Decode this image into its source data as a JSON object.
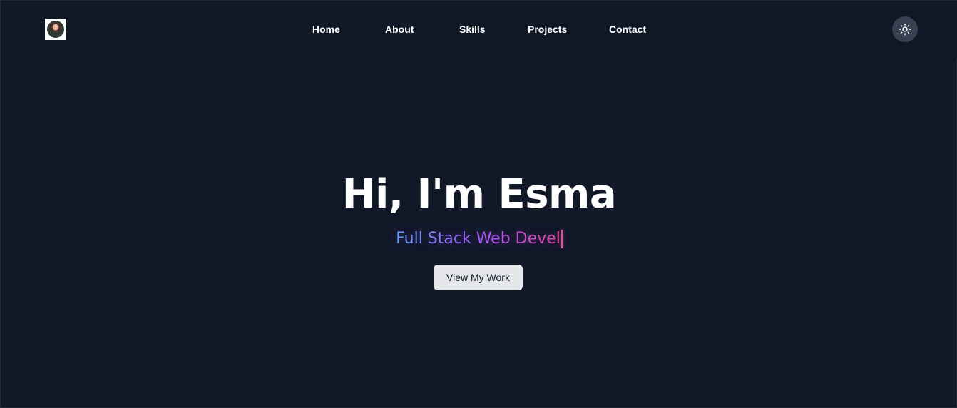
{
  "nav": {
    "links": [
      "Home",
      "About",
      "Skills",
      "Projects",
      "Contact"
    ]
  },
  "hero": {
    "title": "Hi, I'm Esma",
    "subtitle": "Full Stack Web Devel",
    "cta_label": "View My Work"
  },
  "icons": {
    "logo": "avatar-logo",
    "theme_toggle": "sun-icon"
  },
  "colors": {
    "background": "#111827",
    "toggle_bg": "#374151",
    "button_bg": "#e5e7eb",
    "gradient_start": "#60a5fa",
    "gradient_mid": "#a855f7",
    "gradient_end": "#ec4899"
  }
}
